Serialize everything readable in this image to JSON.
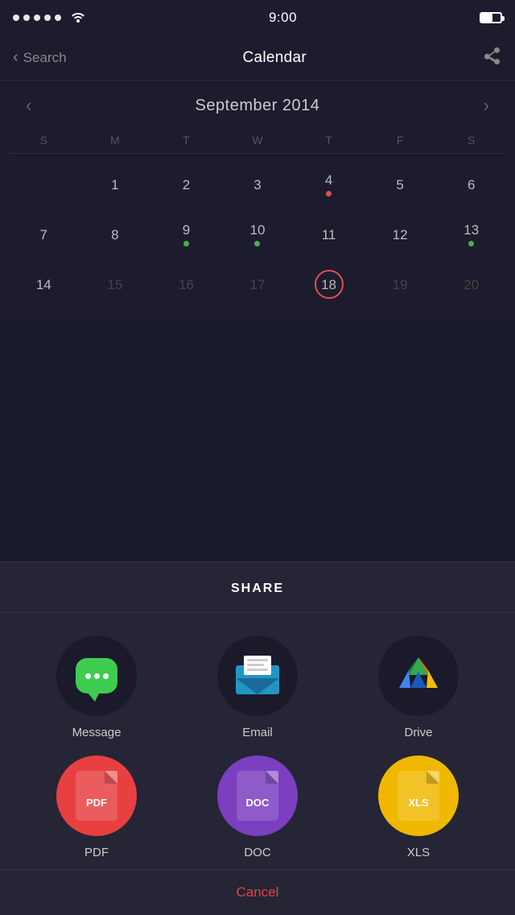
{
  "statusBar": {
    "time": "9:00",
    "dots": 5,
    "wifiLabel": "wifi"
  },
  "navBar": {
    "backLabel": "Search",
    "title": "Calendar",
    "shareIcon": "share"
  },
  "calendar": {
    "monthTitle": "September 2014",
    "weekdays": [
      "S",
      "M",
      "T",
      "W",
      "T",
      "F",
      "S"
    ],
    "weeks": [
      [
        {
          "num": "",
          "empty": true
        },
        {
          "num": "1"
        },
        {
          "num": "2"
        },
        {
          "num": "3"
        },
        {
          "num": "4",
          "dot": "red"
        },
        {
          "num": "5"
        },
        {
          "num": "6"
        }
      ],
      [
        {
          "num": "7"
        },
        {
          "num": "8"
        },
        {
          "num": "9",
          "dot": "green"
        },
        {
          "num": "10",
          "dot": "green"
        },
        {
          "num": "11"
        },
        {
          "num": "12"
        },
        {
          "num": "13",
          "dot": "green"
        }
      ],
      [
        {
          "num": "14"
        },
        {
          "num": "15",
          "faded": true
        },
        {
          "num": "16",
          "faded": true
        },
        {
          "num": "17",
          "faded": true
        },
        {
          "num": "18",
          "today": true
        },
        {
          "num": "19",
          "faded": true
        },
        {
          "num": "20",
          "faded": true
        }
      ]
    ]
  },
  "share": {
    "title": "SHARE",
    "items": [
      {
        "id": "message",
        "label": "Message"
      },
      {
        "id": "email",
        "label": "Email"
      },
      {
        "id": "drive",
        "label": "Drive"
      },
      {
        "id": "pdf",
        "label": "PDF"
      },
      {
        "id": "doc",
        "label": "DOC"
      },
      {
        "id": "xls",
        "label": "XLS"
      }
    ],
    "cancelLabel": "Cancel"
  }
}
